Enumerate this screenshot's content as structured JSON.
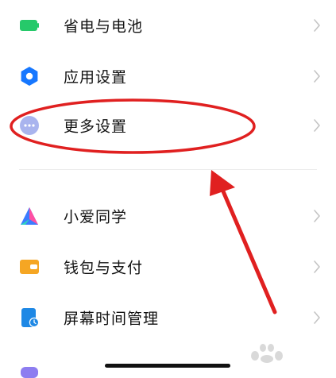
{
  "settings_list": {
    "items": [
      {
        "label": "省电与电池",
        "icon": "battery-icon",
        "icon_color": "#26c96a"
      },
      {
        "label": "应用设置",
        "icon": "gear-icon",
        "icon_color": "#1677ff"
      },
      {
        "label": "更多设置",
        "icon": "more-dots-icon",
        "icon_color": "#a9b4ee"
      },
      {
        "label": "小爱同学",
        "icon": "xiaoai-icon",
        "icon_color": "#3b7cff"
      },
      {
        "label": "钱包与支付",
        "icon": "wallet-icon",
        "icon_color": "#f5a623"
      },
      {
        "label": "屏幕时间管理",
        "icon": "screen-time-icon",
        "icon_color": "#1e88e5"
      }
    ]
  },
  "annotation": {
    "highlighted_item": "更多设置",
    "color": "#e02020"
  }
}
